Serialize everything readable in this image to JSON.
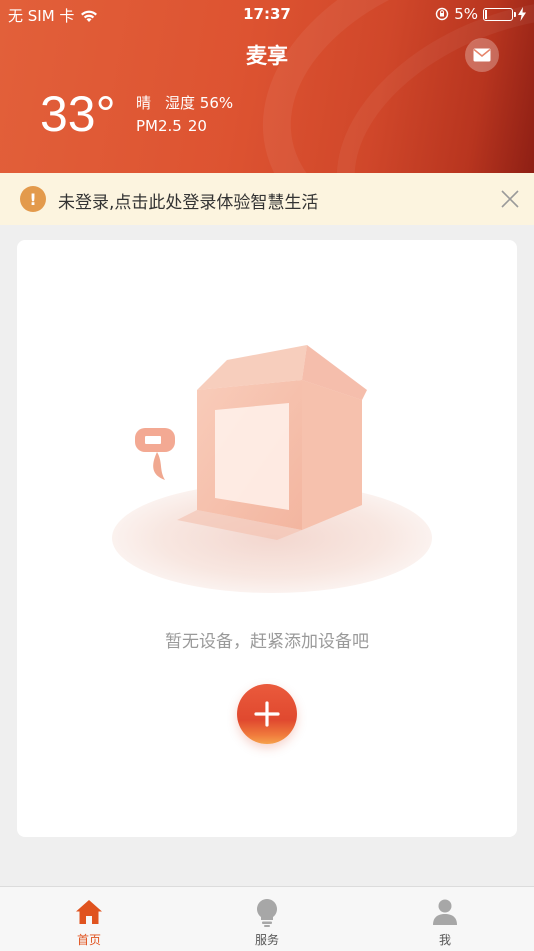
{
  "status_bar": {
    "carrier": "无 SIM 卡",
    "time": "17:37",
    "battery": "5%",
    "battery_level": 0.05
  },
  "header": {
    "title": "麦享",
    "mail_icon": "envelope-icon"
  },
  "weather": {
    "temperature": "33°",
    "condition": "晴",
    "humidity": "湿度 56%",
    "pm_label": "PM2.5",
    "pm_value": "20"
  },
  "notice": {
    "text": "未登录,点击此处登录体验智慧生活",
    "icon": "exclamation-icon",
    "close_icon": "close-icon"
  },
  "empty_state": {
    "message": "暂无设备，赶紧添加设备吧",
    "add_icon": "plus-icon"
  },
  "tabs": [
    {
      "label": "首页",
      "icon": "home-icon",
      "active": true
    },
    {
      "label": "服务",
      "icon": "lightbulb-icon",
      "active": false
    },
    {
      "label": "我",
      "icon": "user-icon",
      "active": false
    }
  ],
  "colors": {
    "brand": "#dd5331",
    "active_tab": "#e0531f",
    "inactive_tab": "#a7a7a7",
    "notice_bg": "#fcf4df",
    "warn": "#e39a4c"
  }
}
